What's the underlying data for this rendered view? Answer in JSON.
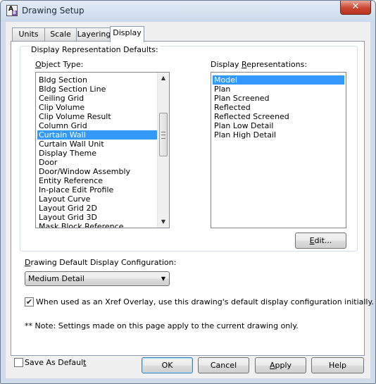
{
  "window": {
    "title": "Drawing Setup",
    "close_glyph": "✕"
  },
  "tabs": [
    {
      "label": "Units",
      "active": false
    },
    {
      "label": "Scale",
      "active": false
    },
    {
      "label": "Layering",
      "active": false
    },
    {
      "label": "Display",
      "active": true
    }
  ],
  "display": {
    "group_label": "Display Representation Defaults:",
    "object_type_label": "Object Type:",
    "object_types": [
      "Bldg Section",
      "Bldg Section Line",
      "Ceiling Grid",
      "Clip Volume",
      "Clip Volume Result",
      "Column Grid",
      "Curtain Wall",
      "Curtain Wall Unit",
      "Display Theme",
      "Door",
      "Door/Window Assembly",
      "Entity Reference",
      "In-place Edit Profile",
      "Layout Curve",
      "Layout Grid 2D",
      "Layout Grid 3D",
      "Mask Block Reference"
    ],
    "object_types_selected": "Curtain Wall",
    "representations_label": "Display Representations:",
    "representations": [
      "Model",
      "Plan",
      "Plan Screened",
      "Reflected",
      "Reflected Screened",
      "Plan Low Detail",
      "Plan High Detail"
    ],
    "representations_selected": "Model",
    "edit_button": "Edit...",
    "config_label": "Drawing Default Display Configuration:",
    "config_value": "Medium Detail",
    "xref_checkbox_checked": true,
    "xref_checkbox_label": "When used as an Xref Overlay, use this drawing's default display configuration initially.",
    "note": "** Note: Settings made on this page apply to the current drawing only."
  },
  "footer": {
    "save_default_label": "Save As Default",
    "save_default_checked": false,
    "ok": "OK",
    "cancel": "Cancel",
    "apply": "Apply",
    "help": "Help"
  }
}
